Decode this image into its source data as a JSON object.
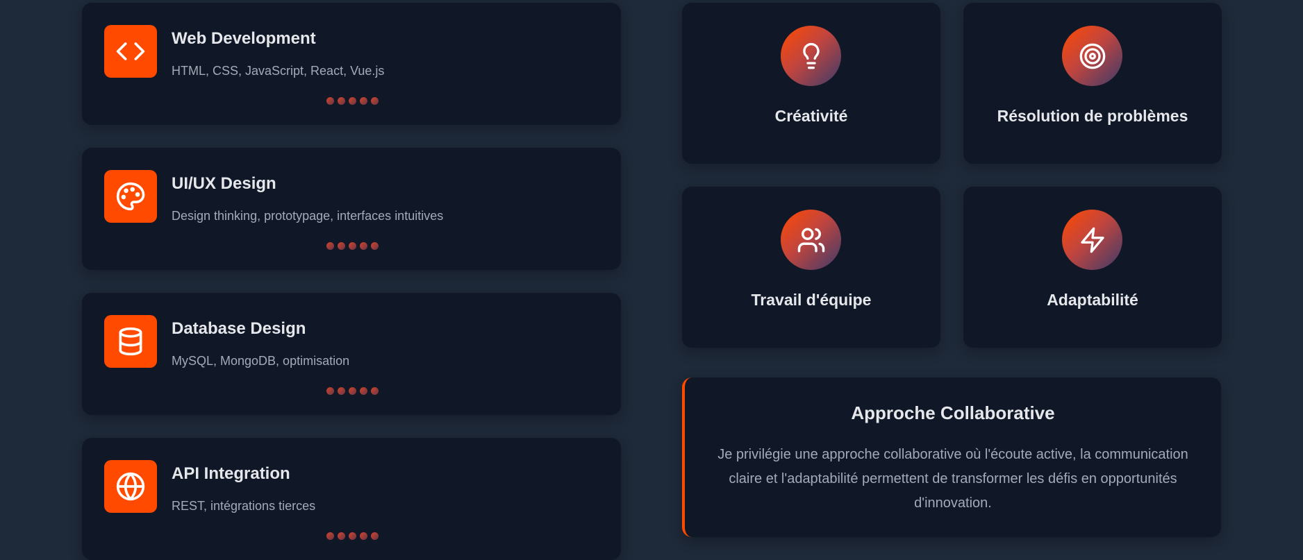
{
  "skills": [
    {
      "title": "Web Development",
      "description": "HTML, CSS, JavaScript, React, Vue.js",
      "icon": "code-icon",
      "level": 5
    },
    {
      "title": "UI/UX Design",
      "description": "Design thinking, prototypage, interfaces intuitives",
      "icon": "palette-icon",
      "level": 5
    },
    {
      "title": "Database Design",
      "description": "MySQL, MongoDB, optimisation",
      "icon": "database-icon",
      "level": 5
    },
    {
      "title": "API Integration",
      "description": "REST, intégrations tierces",
      "icon": "globe-icon",
      "level": 5
    }
  ],
  "soft_skills": [
    {
      "label": "Créativité",
      "icon": "lightbulb-icon"
    },
    {
      "label": "Résolution de problèmes",
      "icon": "target-icon"
    },
    {
      "label": "Travail d'équipe",
      "icon": "users-icon"
    },
    {
      "label": "Adaptabilité",
      "icon": "zap-icon"
    }
  ],
  "collaborative": {
    "title": "Approche Collaborative",
    "text": "Je privilégie une approche collaborative où l'écoute active, la communication claire et l'adaptabilité permettent de transformer les défis en opportunités d'innovation."
  },
  "colors": {
    "background": "#1e2939",
    "card": "#101828",
    "accent": "#ff4a00",
    "text": "#e5e7eb",
    "muted": "#a3abb8"
  }
}
